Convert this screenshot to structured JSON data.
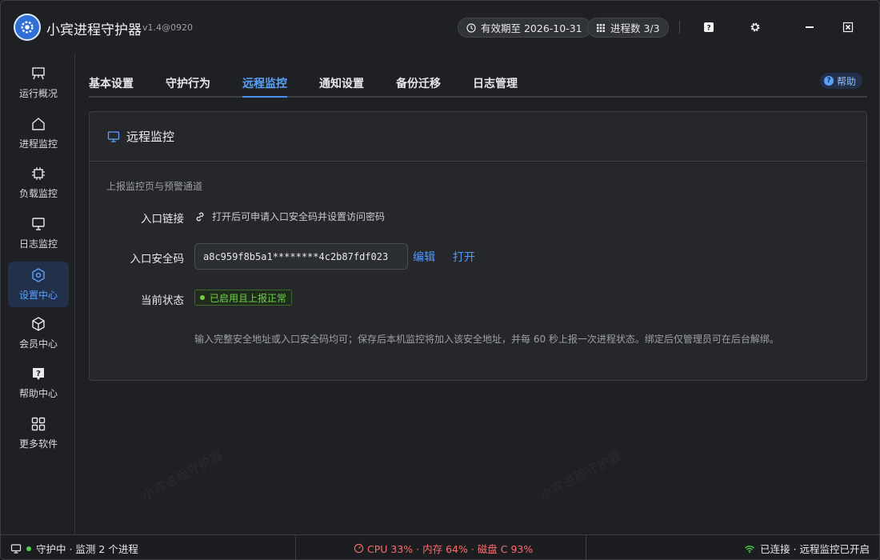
{
  "titlebar": {
    "app_name": "小宾进程守护器",
    "version": "v1.4@0920",
    "expiry": "有效期至 2026-10-31",
    "process_count": "进程数 3/3"
  },
  "sidebar": {
    "items": [
      {
        "label": "运行概况",
        "icon": "easel-icon"
      },
      {
        "label": "进程监控",
        "icon": "home-icon"
      },
      {
        "label": "负载监控",
        "icon": "cpu-chip-icon"
      },
      {
        "label": "日志监控",
        "icon": "monitor-icon"
      },
      {
        "label": "设置中心",
        "icon": "settings-hex-icon"
      },
      {
        "label": "会员中心",
        "icon": "box-icon"
      },
      {
        "label": "帮助中心",
        "icon": "question-bubble-icon"
      },
      {
        "label": "更多软件",
        "icon": "grid-icon"
      }
    ]
  },
  "tabs": [
    "基本设置",
    "守护行为",
    "远程监控",
    "通知设置",
    "备份迁移",
    "日志管理"
  ],
  "help_label": "帮助",
  "panel": {
    "title": "远程监控",
    "subtitle": "上报监控页与预警通道",
    "link_label": "入口链接",
    "link_text": "打开后可申请入口安全码并设置访问密码",
    "code_label": "入口安全码",
    "code_value": "a8c959f8b5a1********4c2b87fdf023",
    "edit_label": "编辑",
    "open_label": "打开",
    "status_label": "当前状态",
    "status_value": "已启用且上报正常",
    "note": "输入完整安全地址或入口安全码均可；保存后本机监控将加入该安全地址，并每 60 秒上报一次进程状态。绑定后仅管理员可在后台解绑。"
  },
  "watermark": "小宾进程守护器",
  "statusbar": {
    "left": "守护中 · 监测 2 个进程",
    "middle": "CPU 33% · 内存 64% · 磁盘 C 93%",
    "right": "已连接 · 远程监控已开启"
  },
  "colors": {
    "accent": "#4a90f0",
    "status_ok": "#6fd14a",
    "warn": "#ff6b6b"
  }
}
